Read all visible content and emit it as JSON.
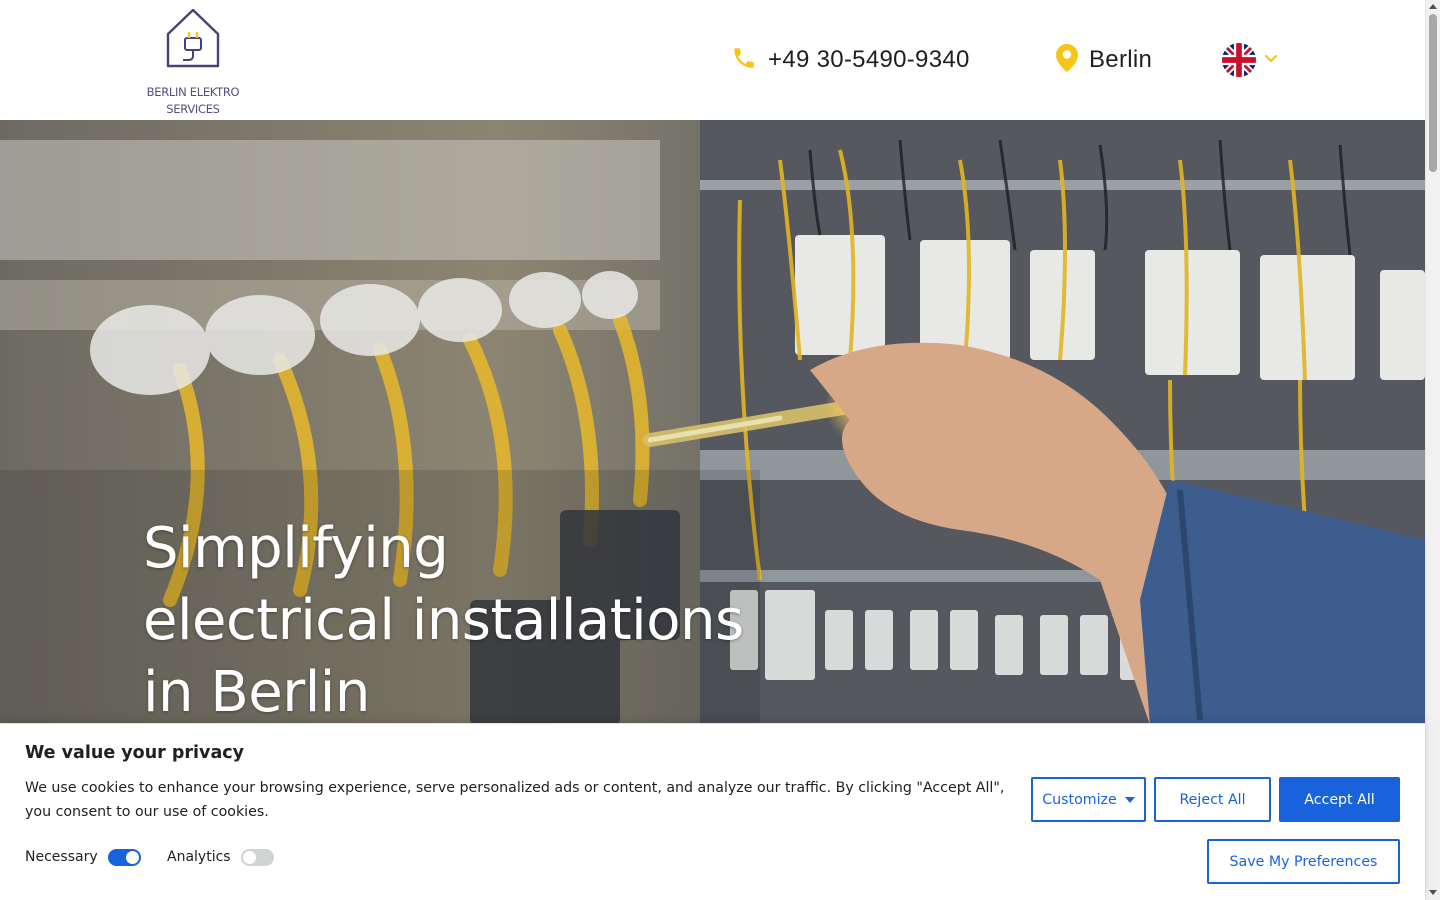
{
  "header": {
    "logo": {
      "line1": "BERLIN ELEKTRO",
      "line2": "SERVICES",
      "icon": "house-plug-icon"
    },
    "phone": {
      "icon": "phone-icon",
      "text": "+49 30-5490-9340"
    },
    "location": {
      "icon": "map-pin-icon",
      "text": "Berlin"
    },
    "language": {
      "icon": "uk-flag-icon",
      "dropdown_icon": "chevron-down-icon"
    }
  },
  "hero": {
    "title_lines": [
      "Simplifying",
      "electrical installations",
      "in Berlin"
    ],
    "image": "electrician-testing-switchboard"
  },
  "cookie_banner": {
    "title": "We value your privacy",
    "text": "We use cookies to enhance your browsing experience, serve personalized ads or content, and analyze our traffic. By clicking \"Accept All\", you consent to our use of cookies.",
    "toggles": [
      {
        "label": "Necessary",
        "enabled": true
      },
      {
        "label": "Analytics",
        "enabled": false
      }
    ],
    "buttons": {
      "customize": "Customize",
      "reject": "Reject All",
      "accept": "Accept All",
      "save": "Save My Preferences"
    }
  },
  "colors": {
    "accent_blue": "#1863dc",
    "icon_yellow": "#f5c518",
    "logo_purple": "#5b4a86"
  }
}
